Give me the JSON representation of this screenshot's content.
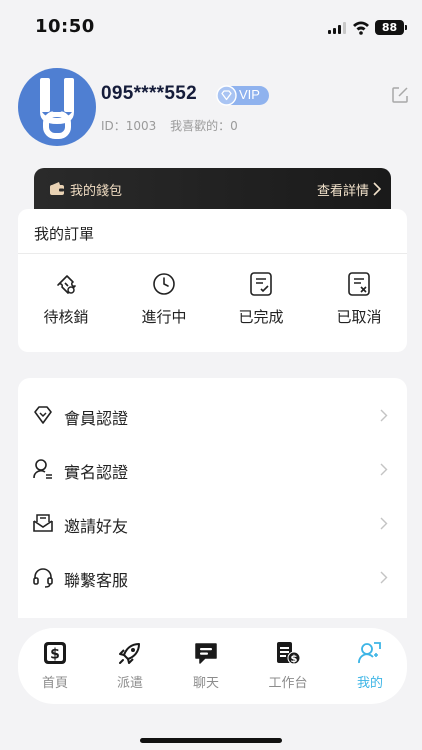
{
  "status_bar": {
    "time": "10:50",
    "battery": "88"
  },
  "profile": {
    "phone": "095****552",
    "vip_label": "VIP",
    "id_text": "ID：1003",
    "likes_text": "我喜歡的：0"
  },
  "wallet": {
    "label": "我的錢包",
    "detail": "查看詳情"
  },
  "orders": {
    "title": "我的訂單",
    "items": [
      {
        "label": "待核銷",
        "icon": "ticket-icon"
      },
      {
        "label": "進行中",
        "icon": "clock-icon"
      },
      {
        "label": "已完成",
        "icon": "document-check-icon"
      },
      {
        "label": "已取消",
        "icon": "document-cancel-icon"
      }
    ]
  },
  "menu": {
    "items": [
      {
        "label": "會員認證",
        "icon": "diamond-icon"
      },
      {
        "label": "實名認證",
        "icon": "user-id-icon"
      },
      {
        "label": "邀請好友",
        "icon": "invite-mail-icon"
      },
      {
        "label": "聯繫客服",
        "icon": "headset-icon"
      }
    ]
  },
  "tabbar": {
    "items": [
      {
        "label": "首頁",
        "icon": "dollar-home-icon"
      },
      {
        "label": "派遣",
        "icon": "rocket-icon"
      },
      {
        "label": "聊天",
        "icon": "chat-icon"
      },
      {
        "label": "工作台",
        "icon": "workbench-icon"
      },
      {
        "label": "我的",
        "icon": "profile-icon",
        "active": true
      }
    ]
  },
  "colors": {
    "accent": "#3db5e6",
    "avatar_bg": "#4f7fd2",
    "vip_badge": "#8fb2ee",
    "wallet_text": "#f0dcc2"
  }
}
